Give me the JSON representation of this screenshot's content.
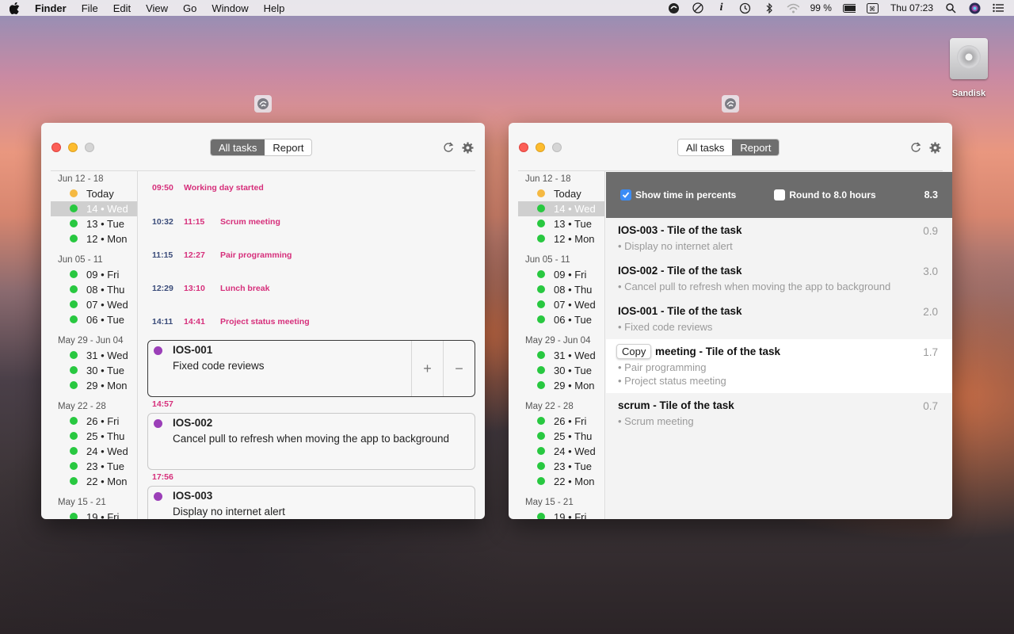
{
  "menubar": {
    "app": "Finder",
    "items": [
      "File",
      "Edit",
      "View",
      "Go",
      "Window",
      "Help"
    ],
    "battery": "99 %",
    "clock": "Thu 07:23"
  },
  "desktop": {
    "disk_label": "Sandisk"
  },
  "sidebar": {
    "weeks": [
      {
        "label": "Jun 12 - 18",
        "days": [
          {
            "label": "Today",
            "status": "orange"
          },
          {
            "label": "14 • Wed",
            "status": "green",
            "selected": true
          },
          {
            "label": "13 • Tue",
            "status": "green"
          },
          {
            "label": "12 • Mon",
            "status": "green"
          }
        ]
      },
      {
        "label": "Jun 05 - 11",
        "days": [
          {
            "label": "09 • Fri",
            "status": "green"
          },
          {
            "label": "08 • Thu",
            "status": "green"
          },
          {
            "label": "07 • Wed",
            "status": "green"
          },
          {
            "label": "06 • Tue",
            "status": "green"
          }
        ]
      },
      {
        "label": "May 29 - Jun 04",
        "days": [
          {
            "label": "31 • Wed",
            "status": "green"
          },
          {
            "label": "30 • Tue",
            "status": "green"
          },
          {
            "label": "29 • Mon",
            "status": "green"
          }
        ]
      },
      {
        "label": "May 22 - 28",
        "days": [
          {
            "label": "26 • Fri",
            "status": "green"
          },
          {
            "label": "25 • Thu",
            "status": "green"
          },
          {
            "label": "24 • Wed",
            "status": "green"
          },
          {
            "label": "23 • Tue",
            "status": "green"
          },
          {
            "label": "22 • Mon",
            "status": "green"
          }
        ]
      },
      {
        "label": "May 15 - 21",
        "days": [
          {
            "label": "19 • Fri",
            "status": "green"
          }
        ]
      }
    ]
  },
  "left_window": {
    "tabs": [
      "All tasks",
      "Report"
    ],
    "active_tab": "All tasks",
    "entries": [
      {
        "start": "09:50",
        "end": "",
        "label": "Working day started"
      },
      {
        "start": "10:32",
        "end": "11:15",
        "label": "Scrum meeting"
      },
      {
        "start": "11:15",
        "end": "12:27",
        "label": "Pair programming"
      },
      {
        "start": "12:29",
        "end": "13:10",
        "label": "Lunch break"
      },
      {
        "start": "14:11",
        "end": "14:41",
        "label": "Project status meeting"
      }
    ],
    "tasks": [
      {
        "time": "",
        "id": "IOS-001",
        "desc": "Fixed code reviews",
        "focused": true,
        "plus": "+",
        "minus": "−"
      },
      {
        "time": "14:57",
        "id": "IOS-002",
        "desc": "Cancel pull to refresh when moving the app to background"
      },
      {
        "time": "17:56",
        "id": "IOS-003",
        "desc": "Display no internet alert"
      }
    ]
  },
  "right_window": {
    "tabs": [
      "All tasks",
      "Report"
    ],
    "active_tab": "Report",
    "show_percents_label": "Show time in percents",
    "round_label": "Round to 8.0 hours",
    "total": "8.3",
    "copy_label": "Copy",
    "items": [
      {
        "title": "IOS-003 - Tile of the task",
        "value": "0.9",
        "subs": [
          "• Display no internet alert"
        ]
      },
      {
        "title": "IOS-002 - Tile of the task",
        "value": "3.0",
        "subs": [
          "• Cancel pull to refresh when moving the app to background"
        ]
      },
      {
        "title": "IOS-001 - Tile of the task",
        "value": "2.0",
        "subs": [
          "• Fixed code reviews"
        ]
      },
      {
        "title": "meeting - Tile of the task",
        "value": "1.7",
        "subs": [
          "• Pair programming",
          "• Project status meeting"
        ],
        "highlight": true
      },
      {
        "title": "scrum - Tile of the task",
        "value": "0.7",
        "subs": [
          "• Scrum meeting"
        ]
      }
    ]
  }
}
